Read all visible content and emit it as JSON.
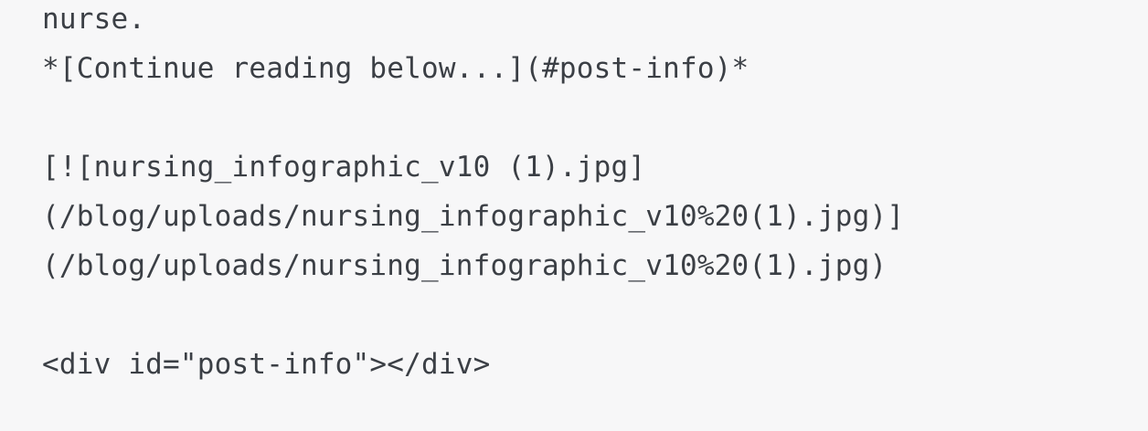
{
  "code": {
    "lines": [
      "nurse.",
      "*[Continue reading below...](#post-info)*",
      "",
      "[![nursing_infographic_v10 (1).jpg]",
      "(/blog/uploads/nursing_infographic_v10%20(1).jpg)]",
      "(/blog/uploads/nursing_infographic_v10%20(1).jpg)",
      "",
      "<div id=\"post-info\"></div>"
    ]
  }
}
